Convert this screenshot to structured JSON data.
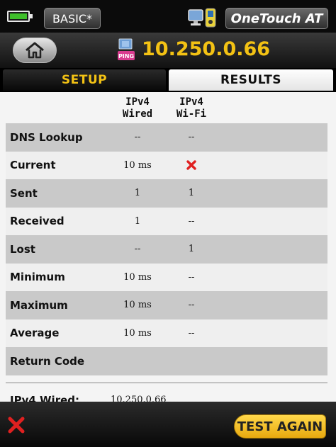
{
  "status_bar": {
    "profile": "BASIC*",
    "brand": "OneTouch AT"
  },
  "title_bar": {
    "ip_address": "10.250.0.66",
    "ping_badge": "PING"
  },
  "tabs": [
    {
      "label": "SETUP",
      "active": false
    },
    {
      "label": "RESULTS",
      "active": true
    }
  ],
  "columns": {
    "wired": "IPv4\nWired",
    "wifi": "IPv4\nWi-Fi"
  },
  "rows": [
    {
      "label": "DNS Lookup",
      "wired": "--",
      "wifi": "--"
    },
    {
      "label": "Current",
      "wired": "10 ms",
      "wifi": "",
      "wifi_status": "fail"
    },
    {
      "label": "Sent",
      "wired": "1",
      "wifi": "1"
    },
    {
      "label": "Received",
      "wired": "1",
      "wifi": "--"
    },
    {
      "label": "Lost",
      "wired": "--",
      "wifi": "1"
    },
    {
      "label": "Minimum",
      "wired": "10 ms",
      "wifi": "--"
    },
    {
      "label": "Maximum",
      "wired": "10 ms",
      "wifi": "--"
    },
    {
      "label": "Average",
      "wired": "10 ms",
      "wifi": "--"
    },
    {
      "label": "Return Code",
      "wired": "",
      "wifi": ""
    }
  ],
  "summary": {
    "label": "IPv4 Wired:",
    "value": "10.250.0.66"
  },
  "footer": {
    "test_button": "TEST AGAIN"
  },
  "colors": {
    "accent_yellow": "#f3c214",
    "fail_red": "#e02020",
    "battery_green": "#3fbf2a"
  }
}
